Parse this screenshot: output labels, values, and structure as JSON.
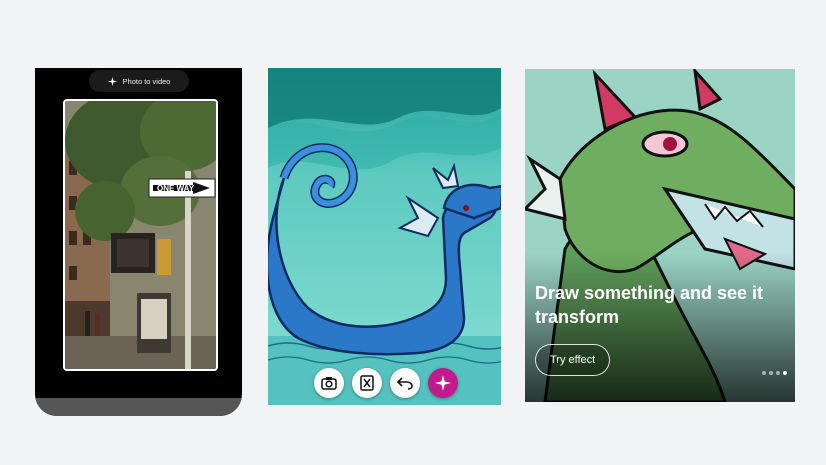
{
  "panel1": {
    "pill_label": "Photo to video",
    "sparkle_icon": "sparkle-icon",
    "street_sign_text": "ONE WAY"
  },
  "panel2": {
    "toolbar_icons": [
      "camera-icon",
      "clear-canvas-icon",
      "undo-icon",
      "sparkle-icon"
    ],
    "magic_color": "#c2198d"
  },
  "panel3": {
    "headline": "Draw something and see it transform",
    "cta_label": "Try effect"
  }
}
